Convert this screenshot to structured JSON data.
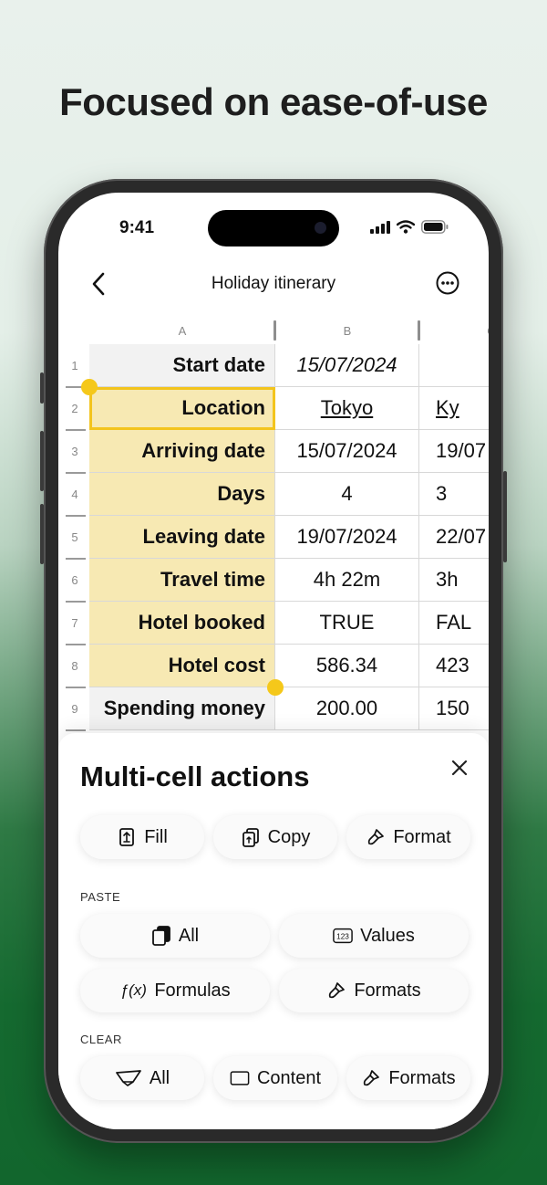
{
  "headline": "Focused on ease-of-use",
  "status_bar": {
    "time": "9:41"
  },
  "nav": {
    "title": "Holiday itinerary"
  },
  "columns": [
    "A",
    "B",
    "C"
  ],
  "rows": [
    {
      "num": "1",
      "a": "Start date",
      "b": "15/07/2024",
      "c": ""
    },
    {
      "num": "2",
      "a": "Location",
      "b": "Tokyo",
      "c": "Ky"
    },
    {
      "num": "3",
      "a": "Arriving date",
      "b": "15/07/2024",
      "c": "19/07"
    },
    {
      "num": "4",
      "a": "Days",
      "b": "4",
      "c": "3"
    },
    {
      "num": "5",
      "a": "Leaving date",
      "b": "19/07/2024",
      "c": "22/07"
    },
    {
      "num": "6",
      "a": "Travel time",
      "b": "4h 22m",
      "c": "3h"
    },
    {
      "num": "7",
      "a": "Hotel booked",
      "b": "TRUE",
      "c": "FAL"
    },
    {
      "num": "8",
      "a": "Hotel cost",
      "b": "586.34",
      "c": "423"
    },
    {
      "num": "9",
      "a": "Spending money",
      "b": "200.00",
      "c": "150"
    }
  ],
  "panel": {
    "title": "Multi-cell actions",
    "actions": [
      {
        "label": "Fill",
        "icon": "fill-icon"
      },
      {
        "label": "Copy",
        "icon": "copy-icon"
      },
      {
        "label": "Format",
        "icon": "format-brush-icon"
      }
    ],
    "paste_label": "PASTE",
    "paste": [
      {
        "label": "All",
        "icon": "paste-all-icon"
      },
      {
        "label": "Values",
        "icon": "values-123-icon"
      },
      {
        "label": "Formulas",
        "icon": "function-icon",
        "icon_text": "ƒ(x)"
      },
      {
        "label": "Formats",
        "icon": "format-brush-icon"
      }
    ],
    "clear_label": "CLEAR",
    "clear": [
      {
        "label": "All",
        "icon": "eraser-icon"
      },
      {
        "label": "Content",
        "icon": "content-box-icon"
      },
      {
        "label": "Formats",
        "icon": "format-brush-icon"
      }
    ]
  },
  "colors": {
    "selection_fill": "#f7e9b3",
    "selection_border": "#f3c41d",
    "brand_green": "#156a30"
  }
}
